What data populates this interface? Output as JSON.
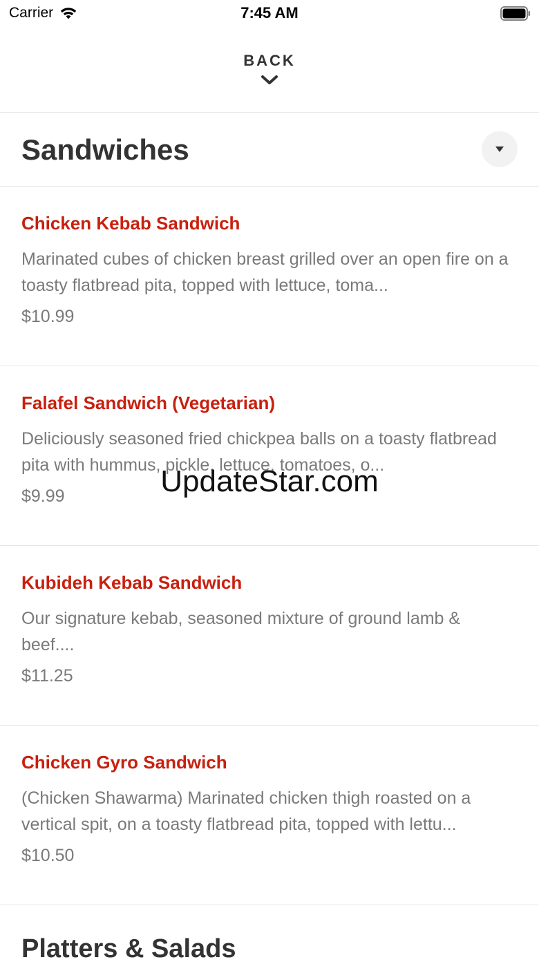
{
  "status_bar": {
    "carrier": "Carrier",
    "time": "7:45 AM",
    "wifi_icon": "wifi-icon",
    "battery_icon": "battery-icon"
  },
  "nav": {
    "back_label": "BACK",
    "back_icon": "chevron-down-icon"
  },
  "category": {
    "title": "Sandwiches",
    "toggle_icon": "caret-down-icon"
  },
  "items": [
    {
      "name": "Chicken Kebab Sandwich",
      "description": "Marinated cubes of chicken breast grilled over an open fire on a toasty flatbread pita, topped with lettuce, toma...",
      "price": "$10.99"
    },
    {
      "name": "Falafel Sandwich (Vegetarian)",
      "description": "Deliciously seasoned fried chickpea balls on a toasty flatbread pita with hummus, pickle, lettuce, tomatoes, o...",
      "price": "$9.99"
    },
    {
      "name": "Kubideh Kebab Sandwich",
      "description": "Our signature kebab, seasoned mixture of ground lamb & beef....",
      "price": "$11.25"
    },
    {
      "name": "Chicken Gyro Sandwich",
      "description": "(Chicken Shawarma) Marinated chicken thigh roasted on a vertical spit, on a toasty flatbread pita, topped with lettu...",
      "price": "$10.50"
    }
  ],
  "next_category": {
    "title": "Platters & Salads"
  },
  "watermark": "UpdateStar.com",
  "colors": {
    "accent": "#c8200f",
    "text_primary": "#333333",
    "text_secondary": "#7a7a7a",
    "divider": "#e6e6e6"
  }
}
